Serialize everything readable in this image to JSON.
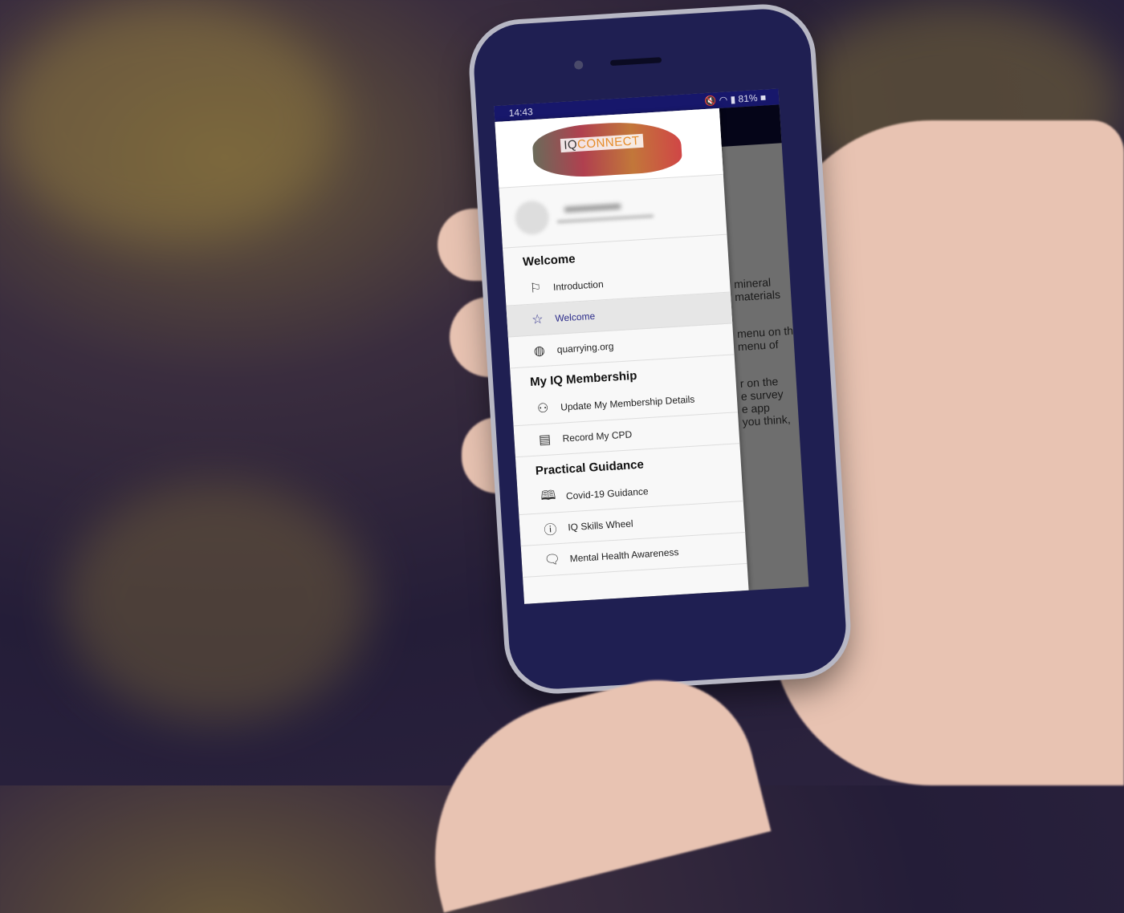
{
  "status_bar": {
    "time": "14:43",
    "icons": [
      "mute-icon",
      "wifi-icon",
      "signal-icon"
    ],
    "battery": "81%"
  },
  "logo": {
    "iq": "IQ",
    "connect": "CONNECT"
  },
  "background_text": [
    "mineral",
    "materials",
    "menu on the",
    "menu of",
    "r on the",
    "e survey",
    "e app",
    "you think,"
  ],
  "drawer": {
    "sections": [
      {
        "title": "Welcome",
        "items": [
          {
            "label": "Introduction",
            "icon": "signpost-icon"
          },
          {
            "label": "Welcome",
            "icon": "star-icon",
            "active": true
          },
          {
            "label": "quarrying.org",
            "icon": "globe-icon"
          }
        ]
      },
      {
        "title": "My IQ Membership",
        "items": [
          {
            "label": "Update My Membership Details",
            "icon": "users-icon"
          },
          {
            "label": "Record My CPD",
            "icon": "certificate-icon"
          }
        ]
      },
      {
        "title": "Practical Guidance",
        "items": [
          {
            "label": "Covid-19 Guidance",
            "icon": "book-icon"
          },
          {
            "label": "IQ Skills Wheel",
            "icon": "info-icon"
          },
          {
            "label": "Mental Health Awareness",
            "icon": "chat-icon"
          }
        ]
      }
    ]
  },
  "colors": {
    "status_bar": "#17176b",
    "active_text": "#2b2b8a",
    "logo_accent": "#e58c2a"
  }
}
